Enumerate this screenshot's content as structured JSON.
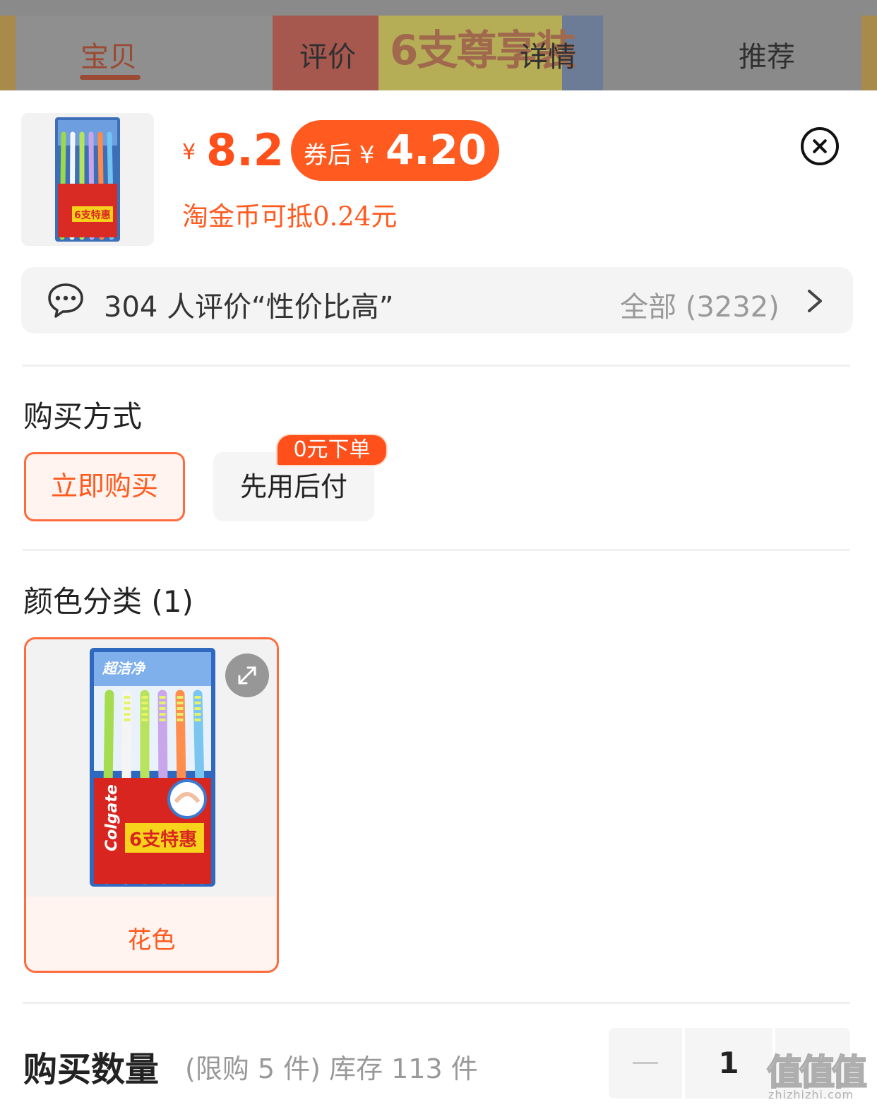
{
  "tabs": [
    {
      "label": "宝贝",
      "active": true
    },
    {
      "label": "评价",
      "active": false
    },
    {
      "label": "详情",
      "active": false
    },
    {
      "label": "推荐",
      "active": false
    }
  ],
  "banner_text": "6支尊享装",
  "product": {
    "currency_symbol": "¥",
    "price": "8.2",
    "coupon_label": "券后 ¥",
    "coupon_price": "4.20",
    "coin_note": "淘金币可抵0.24元",
    "package_text": "6支特惠",
    "brand_text": "Colgate"
  },
  "reviews": {
    "summary": "304 人评价“性价比高”",
    "all_label": "全部 (3232)"
  },
  "purchase_method": {
    "title": "购买方式",
    "options": [
      {
        "label": "立即购买",
        "selected": true
      },
      {
        "label": "先用后付",
        "selected": false,
        "badge": "0元下单"
      }
    ]
  },
  "color_category": {
    "title": "颜色分类 (1)",
    "items": [
      {
        "label": "花色",
        "selected": true
      }
    ]
  },
  "quantity": {
    "title": "购买数量",
    "limit_text": "(限购 5 件) 库存 113 件",
    "value": "1"
  },
  "watermark": {
    "main": "值值值",
    "sub": "zhizhizhi.com"
  },
  "colors": {
    "accent": "#ff5a1f",
    "selected_border": "#ff6b3d",
    "selected_bg": "#fff4ef"
  }
}
